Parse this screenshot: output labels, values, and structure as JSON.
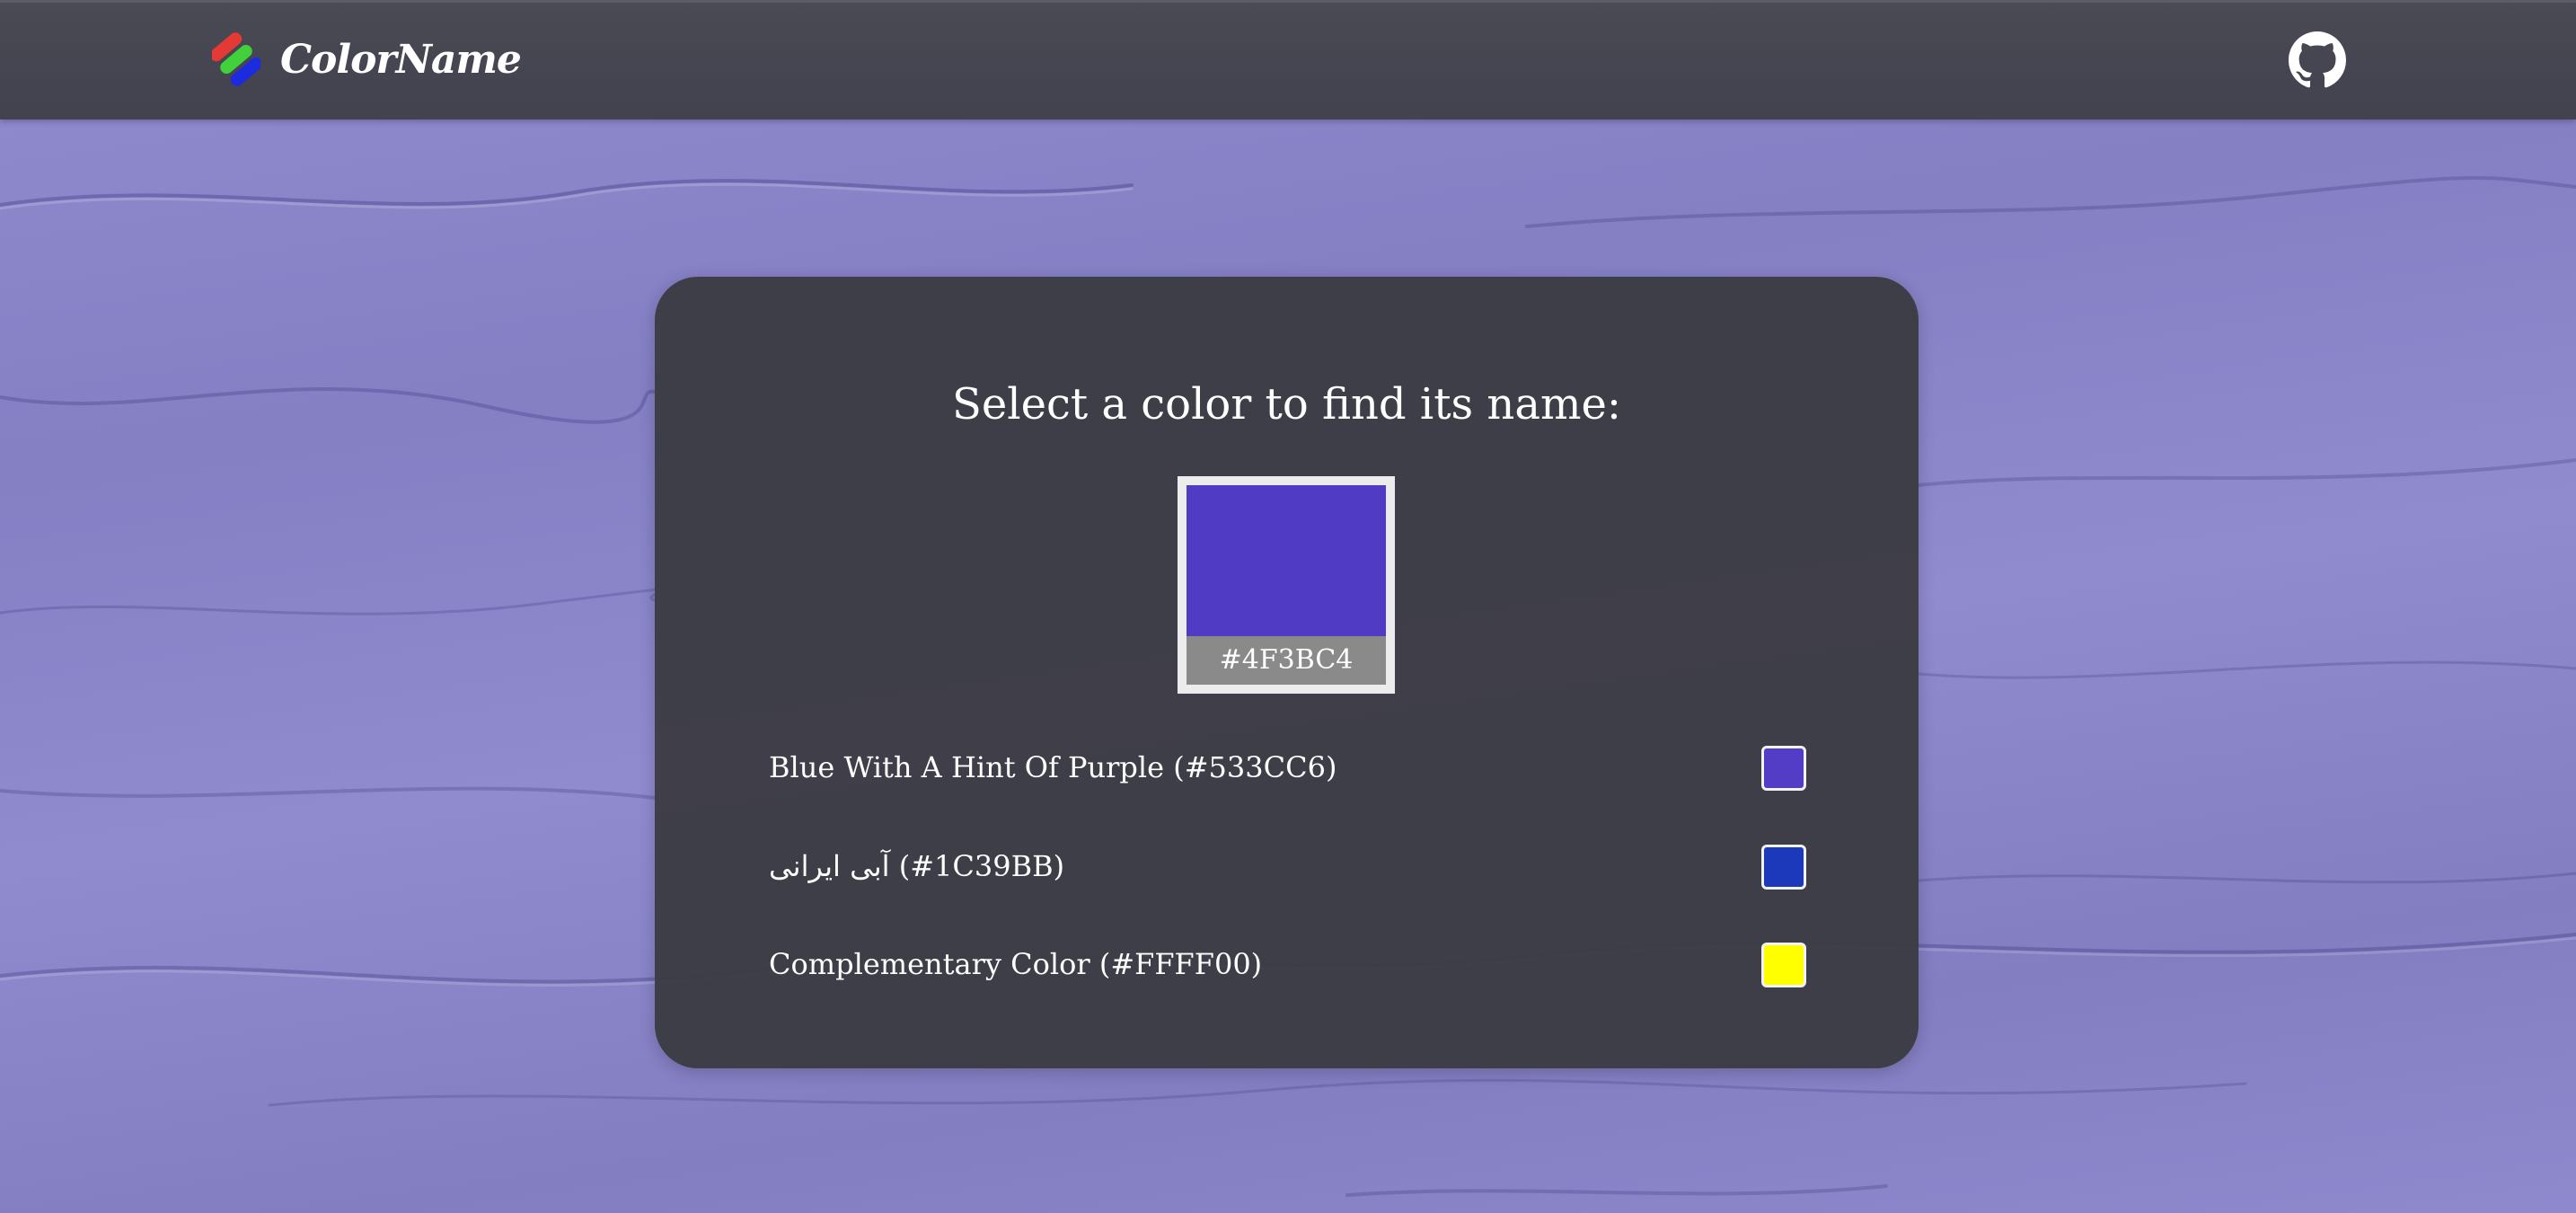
{
  "app": {
    "name": "ColorName",
    "logo_icon": "colorname-logo-icon",
    "github_icon": "github-icon"
  },
  "main": {
    "title": "Select a color to find its name:",
    "picker": {
      "hex_label": "#4F3BC4",
      "color": "#4F3BC4"
    },
    "results": [
      {
        "label": "Blue With A Hint Of Purple (#533CC6)",
        "color": "#533CC6"
      },
      {
        "label": "آبی ایرانی (#1C39BB)",
        "color": "#1C39BB"
      },
      {
        "label": "Complementary Color (#FFFF00)",
        "color": "#FFFF00"
      }
    ]
  },
  "colors": {
    "background": "#8A84CC",
    "navbar": "#45454F",
    "card": "#3C3C44",
    "text": "#FFFFFF"
  }
}
